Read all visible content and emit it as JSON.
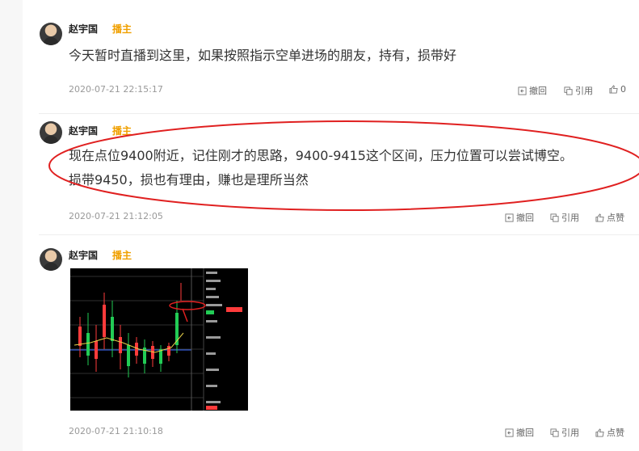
{
  "posts": [
    {
      "author": "赵宇国",
      "badge": "播主",
      "text": "今天暂时直播到这里，如果按照指示空单进场的朋友，持有，损带好",
      "time": "2020-07-21 22:15:17",
      "actions": {
        "revoke": "撤回",
        "quote": "引用",
        "like_count": "0"
      }
    },
    {
      "author": "赵宇国",
      "badge": "播主",
      "text_line1": "现在点位9400附近，记住刚才的思路，9400-9415这个区间，压力位置可以尝试博空。",
      "text_line2": "损带9450，损也有理由，赚也是理所当然",
      "time": "2020-07-21 21:12:05",
      "actions": {
        "revoke": "撤回",
        "quote": "引用",
        "like": "点赞"
      }
    },
    {
      "author": "赵宇国",
      "badge": "播主",
      "time": "2020-07-21 21:10:18",
      "actions": {
        "revoke": "撤回",
        "quote": "引用",
        "like": "点赞"
      }
    }
  ],
  "colors": {
    "badge": "#f0a000",
    "highlight_ellipse": "#e02020",
    "chart_bg": "#000000",
    "candle_up": "#ff3b3b",
    "candle_down": "#22cc55",
    "support_line": "#3b6cff"
  },
  "icons": {
    "revoke": "undo-icon",
    "quote": "quote-icon",
    "like": "thumbs-up-icon"
  }
}
